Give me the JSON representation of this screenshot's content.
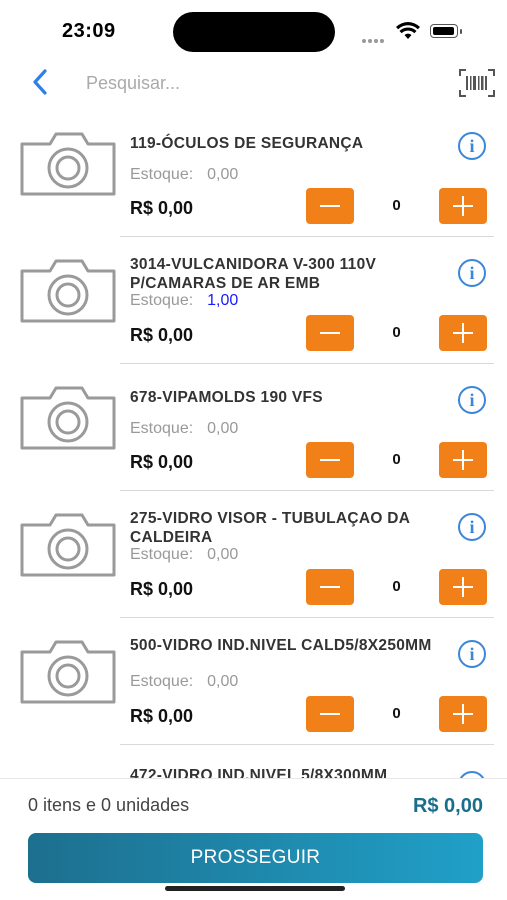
{
  "status_bar": {
    "time": "23:09"
  },
  "header": {
    "back_icon": "chevron-left-icon",
    "search_placeholder": "Pesquisar...",
    "barcode_icon": "barcode-scanner-icon"
  },
  "products": [
    {
      "name": "119-ÓCULOS DE SEGURANÇA",
      "stock_label": "Estoque:",
      "stock_value": "0,00",
      "price": "R$ 0,00",
      "quantity": "0"
    },
    {
      "name": "3014-VULCANIDORA V-300 110V P/CAMARAS DE AR EMB",
      "stock_label": "Estoque:",
      "stock_value": "1,00",
      "price": "R$ 0,00",
      "quantity": "0"
    },
    {
      "name": "678-VIPAMOLDS 190 VFS",
      "stock_label": "Estoque:",
      "stock_value": "0,00",
      "price": "R$ 0,00",
      "quantity": "0"
    },
    {
      "name": "275-VIDRO VISOR - TUBULAÇAO DA CALDEIRA",
      "stock_label": "Estoque:",
      "stock_value": "0,00",
      "price": "R$ 0,00",
      "quantity": "0"
    },
    {
      "name": "500-VIDRO IND.NIVEL CALD5/8X250MM",
      "stock_label": "Estoque:",
      "stock_value": "0,00",
      "price": "R$ 0,00",
      "quantity": "0"
    },
    {
      "name": "472-VIDRO IND.NIVEL 5/8X300MM",
      "stock_label": "",
      "stock_value": "",
      "price": "",
      "quantity": ""
    }
  ],
  "icons": {
    "product_image": "camera-icon",
    "info": "info-icon",
    "minus": "minus-icon",
    "plus": "plus-icon"
  },
  "footer": {
    "summary": "0 itens e 0 unidades",
    "total": "R$ 0,00",
    "proceed_label": "PROSSEGUIR"
  },
  "colors": {
    "accent": "#f28019",
    "info_blue": "#3a86d8",
    "primary_teal": "#1d6f8e",
    "stock_positive": "#1a1aff"
  }
}
